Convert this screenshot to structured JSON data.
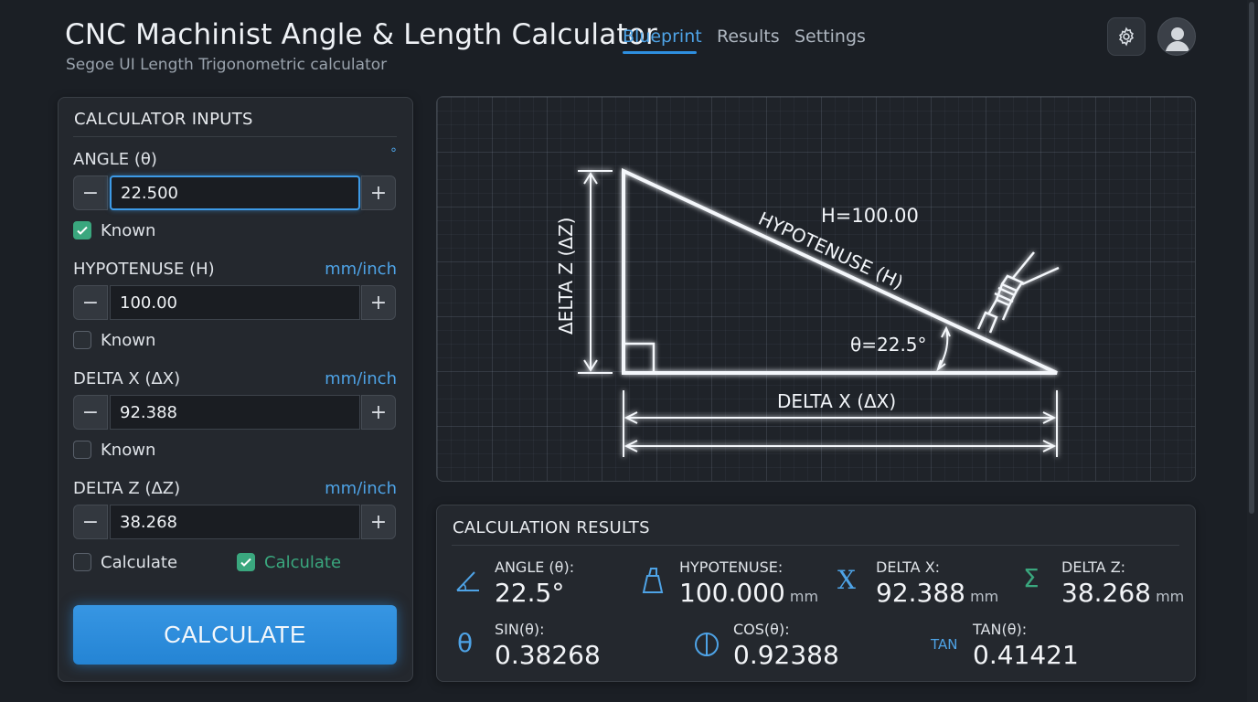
{
  "header": {
    "title": "CNC Machinist Angle & Length Calculator",
    "subtitle": "Segoe UI Length Trigonometric calculator",
    "tabs": [
      {
        "label": "Blueprint",
        "active": true
      },
      {
        "label": "Results",
        "active": false
      },
      {
        "label": "Settings",
        "active": false
      }
    ],
    "settings_icon": "gear-icon",
    "avatar_icon": "user-avatar-icon"
  },
  "inputs": {
    "title": "CALCULATOR INPUTS",
    "fields": [
      {
        "label": "ANGLE (θ)",
        "unit": "°",
        "value": "22.500",
        "known_label": "Known",
        "known": true
      },
      {
        "label": "HYPOTENUSE (H)",
        "unit": "mm/inch",
        "value": "100.00",
        "known_label": "Known",
        "known": false
      },
      {
        "label": "DELTA X (ΔX)",
        "unit": "mm/inch",
        "value": "92.388",
        "known_label": "Known",
        "known": false
      },
      {
        "label": "DELTA Z (ΔZ)",
        "unit": "mm/inch",
        "value": "38.268"
      }
    ],
    "minus": "−",
    "plus": "+",
    "calc_options": [
      {
        "label": "Calculate",
        "checked": false
      },
      {
        "label": "Calculate",
        "checked": true
      }
    ],
    "calculate_button": "CALCULATE"
  },
  "diagram": {
    "h_value": "H=100.00",
    "hyp_label": "HYPOTENUSE (H)",
    "angle_label": "θ=22.5°",
    "dz_label": "ΔELTA Z (ΔZ)",
    "dx_label": "DELTA X (ΔX)"
  },
  "results": {
    "title": "CALCULATION RESULTS",
    "items": [
      {
        "label": "ANGLE (θ):",
        "value": "22.5°",
        "unit": "",
        "icon": "angle-icon"
      },
      {
        "label": "HYPOTENUSE:",
        "value": "100.000",
        "unit": "mm",
        "icon": "hypotenuse-icon"
      },
      {
        "label": "DELTA X:",
        "value": "92.388",
        "unit": "mm",
        "icon": "x-icon"
      },
      {
        "label": "DELTA Z:",
        "value": "38.268",
        "unit": "mm",
        "icon": "sigma-icon"
      },
      {
        "label": "SIN(θ):",
        "value": "0.38268",
        "unit": "",
        "icon": "theta-icon"
      },
      {
        "label": "COS(θ):",
        "value": "0.92388",
        "unit": "",
        "icon": "phi-icon"
      },
      {
        "label": "TAN(θ):",
        "value": "0.41421",
        "unit": "",
        "icon": "tan-icon",
        "icon_text": "TAN"
      }
    ]
  },
  "colors": {
    "accent": "#2e8fe0",
    "check_green": "#3aa77e",
    "background": "#1b1f25",
    "panel": "#24282e"
  }
}
